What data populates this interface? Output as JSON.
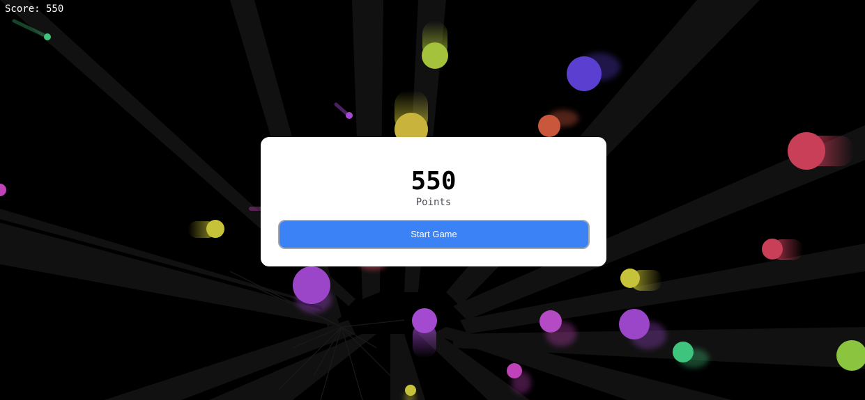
{
  "hud": {
    "score_text": "Score: 550"
  },
  "modal": {
    "score_value": "550",
    "score_label": "Points",
    "start_button_label": "Start Game"
  },
  "colors": {
    "background": "#000000",
    "modal_background": "#ffffff",
    "button_background": "#3b82f6",
    "button_border": "#9fa7b3",
    "orb_purple": "#9b45c9",
    "orb_indigo": "#5b3fd0",
    "orb_yellow": "#c6c23a",
    "orb_lime": "#8bc43f",
    "orb_red": "#c93f58",
    "orb_orange": "#c9573c",
    "orb_magenta": "#bf42b8",
    "orb_green": "#3fc47d"
  }
}
